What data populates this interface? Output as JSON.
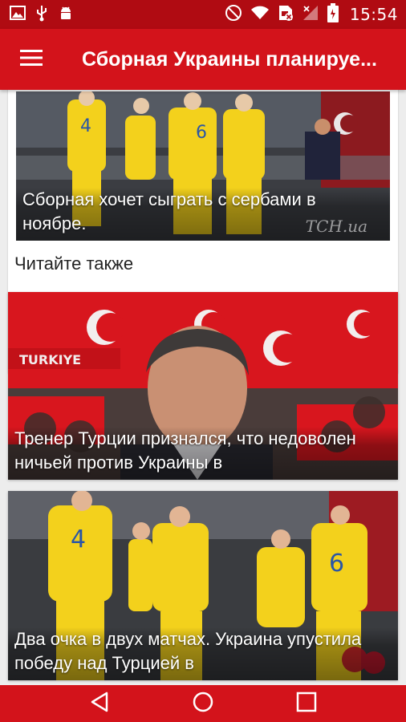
{
  "status_bar": {
    "time": "15:54",
    "icons": [
      "image-icon",
      "usb-icon",
      "android-icon",
      "do-not-disturb-icon",
      "wifi-icon",
      "no-sim-icon",
      "signal-icon",
      "battery-icon"
    ]
  },
  "app_bar": {
    "title": "Сборная Украины планируе...",
    "menu_icon": "hamburger-menu-icon"
  },
  "article": {
    "image_caption": "Сборная хочет сыграть с сербами в ноябре.",
    "watermark": "TCH.ua"
  },
  "section": {
    "see_also": "Читайте также"
  },
  "news": [
    {
      "caption": "Тренер Турции признался, что недоволен ничьей против Украины в"
    },
    {
      "caption": "Два очка в двух матчах. Украина упустила победу над Турцией в"
    }
  ],
  "nav_bar": {
    "icons": [
      "back-icon",
      "home-icon",
      "recents-icon"
    ]
  },
  "colors": {
    "status_bar": "#b00b12",
    "app_bar": "#d3131b",
    "jersey_yellow": "#f3d11c",
    "turkey_red": "#d8161e"
  }
}
